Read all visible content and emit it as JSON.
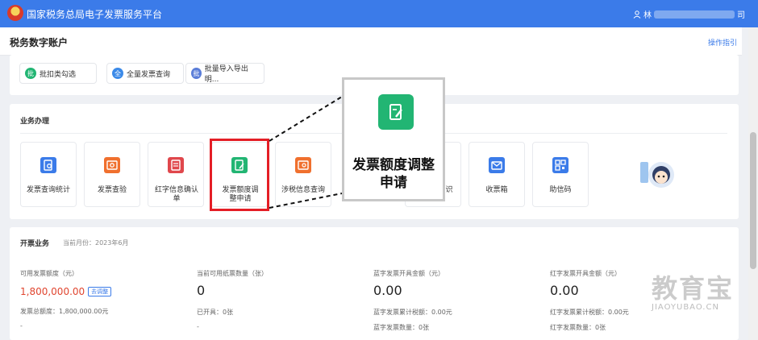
{
  "header": {
    "title": "国家税务总局电子发票服务平台",
    "user_name": "林",
    "user_suffix": "司"
  },
  "subheader": {
    "title": "税务数字账户",
    "guide": "操作指引"
  },
  "quick_links": [
    {
      "icon": "批",
      "label": "批扣类勾选",
      "color": "#22b573"
    },
    {
      "icon": "全",
      "label": "全量发票查询",
      "color": "#3b8ae8"
    },
    {
      "icon": "批",
      "label": "批量导入导出明...",
      "color": "#5a7dd8"
    }
  ],
  "business": {
    "title": "业务办理",
    "tiles": [
      {
        "label": "发票查询统计",
        "icon": "invoice-search-icon",
        "color": "#3b7be9"
      },
      {
        "label": "发票查验",
        "icon": "invoice-verify-icon",
        "color": "#f0702e"
      },
      {
        "label": "红字信息确认单",
        "icon": "red-letter-icon",
        "color": "#e0474c"
      },
      {
        "label": "发票额度调整申请",
        "icon": "quota-adjust-icon",
        "color": "#22b573"
      },
      {
        "label": "涉税信息查询",
        "icon": "tax-info-search-icon",
        "color": "#f0702e"
      },
      {
        "label": "识",
        "icon": "unknown-icon",
        "color": "#3b7be9"
      },
      {
        "label": "收票箱",
        "icon": "mailbox-icon",
        "color": "#3b7be9"
      },
      {
        "label": "助信码",
        "icon": "qr-code-icon",
        "color": "#3b7be9"
      }
    ]
  },
  "callout": {
    "line1": "发票额度调整",
    "line2": "申请"
  },
  "issuing": {
    "title": "开票业务",
    "month_label": "当前月份：2023年6月",
    "metrics": [
      {
        "label": "可用发票额度（元）",
        "value": "1,800,000.00",
        "action": "去调整",
        "line1": "发票总额度：1,800,000.00元",
        "line2": "-"
      },
      {
        "label": "当前可用纸票数量（张）",
        "value": "0",
        "line1": "已开具：0张",
        "line2": "-"
      },
      {
        "label": "蓝字发票开具金额（元）",
        "value": "0.00",
        "line1": "蓝字发票累计税额：0.00元",
        "line2": "蓝字发票数量：0张"
      },
      {
        "label": "红字发票开具金额（元）",
        "value": "0.00",
        "line1": "红字发票累计税额：0.00元",
        "line2": "红字发票数量：0张"
      }
    ]
  },
  "watermark": {
    "cn": "教育宝",
    "en": "JIAOYUBAO.CN"
  }
}
